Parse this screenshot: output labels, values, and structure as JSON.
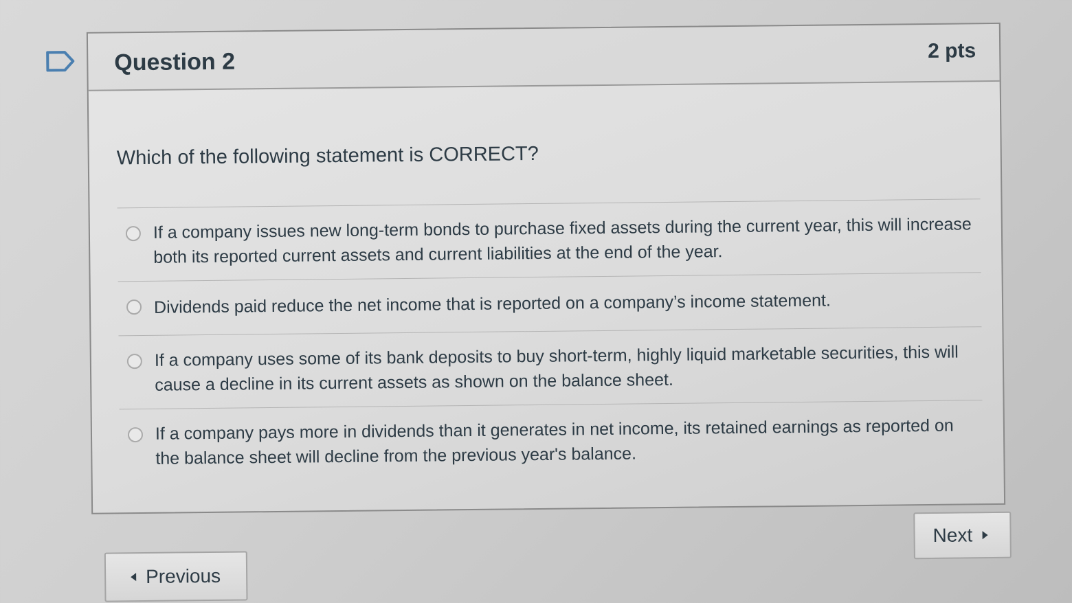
{
  "question": {
    "title": "Question 2",
    "points": "2 pts",
    "text": "Which of the following statement is CORRECT?",
    "answers": [
      {
        "label": "If a company issues new long-term bonds to purchase fixed assets during the current year, this will increase both its reported current assets and current liabilities at the end of the year.",
        "selected": false
      },
      {
        "label": "Dividends paid reduce the net income that is reported on a company’s income statement.",
        "selected": false
      },
      {
        "label": "If a company uses some of its bank deposits to buy short-term, highly liquid marketable securities, this will cause a decline in its current assets as shown on the balance sheet.",
        "selected": false
      },
      {
        "label": "If a company pays more in dividends than it generates in net income, its retained earnings as reported on the balance sheet will decline from the previous year's balance.",
        "selected": false
      }
    ]
  },
  "navigation": {
    "next_label": "Next",
    "previous_label": "Previous"
  },
  "icons": {
    "flag": "flag-bookmark-icon",
    "next": "caret-right-icon",
    "previous": "caret-left-icon"
  },
  "colors": {
    "text": "#2d3b45",
    "flag": "#4a7fb0"
  }
}
